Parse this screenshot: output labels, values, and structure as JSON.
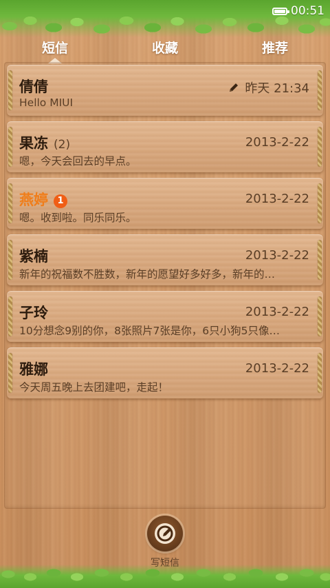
{
  "status_bar": {
    "time": "00:51",
    "battery_icon": "battery-icon"
  },
  "tabs": [
    {
      "label": "短信",
      "active": true
    },
    {
      "label": "收藏",
      "active": false
    },
    {
      "label": "推荐",
      "active": false
    }
  ],
  "conversations": [
    {
      "name": "倩倩",
      "count": "",
      "badge": "",
      "date": "昨天 21:34",
      "preview": "Hello MIUI",
      "draft": true,
      "unread": false
    },
    {
      "name": "果冻",
      "count": "(2)",
      "badge": "",
      "date": "2013-2-22",
      "preview": "嗯，今天会回去的早点。",
      "draft": false,
      "unread": false
    },
    {
      "name": "燕婷",
      "count": "",
      "badge": "1",
      "date": "2013-2-22",
      "preview": "嗯。收到啦。同乐同乐。",
      "draft": false,
      "unread": true
    },
    {
      "name": "紫楠",
      "count": "",
      "badge": "",
      "date": "2013-2-22",
      "preview": "新年的祝福数不胜数，新年的愿望好多好多，新年的…",
      "draft": false,
      "unread": false
    },
    {
      "name": "子玲",
      "count": "",
      "badge": "",
      "date": "2013-2-22",
      "preview": "10分想念9别的你，8张照片7张是你，6只小狗5只像…",
      "draft": false,
      "unread": false
    },
    {
      "name": "雅娜",
      "count": "",
      "badge": "",
      "date": "2013-2-22",
      "preview": "今天周五晚上去团建吧，走起！",
      "draft": false,
      "unread": false
    }
  ],
  "compose": {
    "label": "写短信",
    "icon": "compose-icon"
  },
  "colors": {
    "unread_name": "#f07d19",
    "badge": "#f05e15",
    "text": "#2d1c0e",
    "secondary_text": "#5a3e26"
  }
}
